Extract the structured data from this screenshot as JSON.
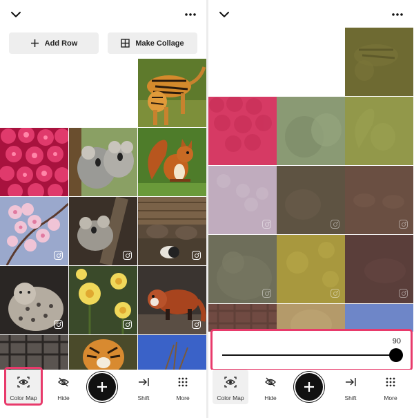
{
  "left_panel": {
    "buttons": {
      "add_row": "Add Row",
      "make_collage": "Make Collage"
    }
  },
  "toolbar": {
    "color_map": "Color Map",
    "hide": "Hide",
    "shift": "Shift",
    "more": "More"
  },
  "right_panel": {
    "slider": {
      "value": "90",
      "level": 0.9
    }
  },
  "colors": {
    "accent_highlight": "#e83a6b",
    "color_map_tiles": [
      "#6e6a32",
      "#d63a64",
      "#8a9a74",
      "#92984a",
      "#c0acbe",
      "#5e5342",
      "#6a4f42",
      "#6e6e5a",
      "#a8983e",
      "#5a3e3a",
      "#704a42",
      "#b49a6a",
      "#6e86c8"
    ]
  }
}
